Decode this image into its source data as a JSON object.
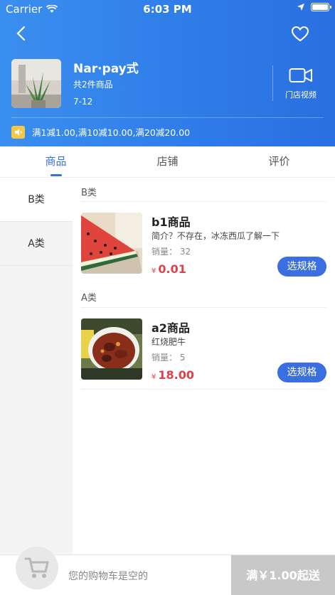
{
  "status_bar": {
    "carrier": "Carrier",
    "time": "6:03 PM"
  },
  "store": {
    "name": "Nar·pay式",
    "product_count": "共2件商品",
    "hours": "7-12",
    "video_label": "门店视频",
    "promo": "满1减1.00,满10减10.00,满20减20.00"
  },
  "tabs": [
    {
      "label": "商品",
      "active": true
    },
    {
      "label": "店铺",
      "active": false
    },
    {
      "label": "评价",
      "active": false
    }
  ],
  "sidebar": {
    "items": [
      {
        "label": "B类",
        "active": true
      },
      {
        "label": "A类",
        "active": false
      }
    ]
  },
  "sections": [
    {
      "title": "B类",
      "product": {
        "name": "b1商品",
        "desc": "简介？不存在，冰冻西瓜了解一下",
        "sales": "销量：  32",
        "currency": "¥",
        "price": "0.01",
        "button": "选规格",
        "image": "watermelon"
      }
    },
    {
      "title": "A类",
      "product": {
        "name": "a2商品",
        "desc": "红烧肥牛",
        "sales": "销量：  5",
        "currency": "¥",
        "price": "18.00",
        "button": "选规格",
        "image": "braised-beef"
      }
    }
  ],
  "cart": {
    "empty_text": "您的购物车是空的",
    "checkout_label": "满￥1.00起送"
  },
  "colors": {
    "accent": "#3b6fe0",
    "header_start": "#3b8ff0",
    "header_end": "#2a6fe0",
    "price": "#e0404a"
  }
}
